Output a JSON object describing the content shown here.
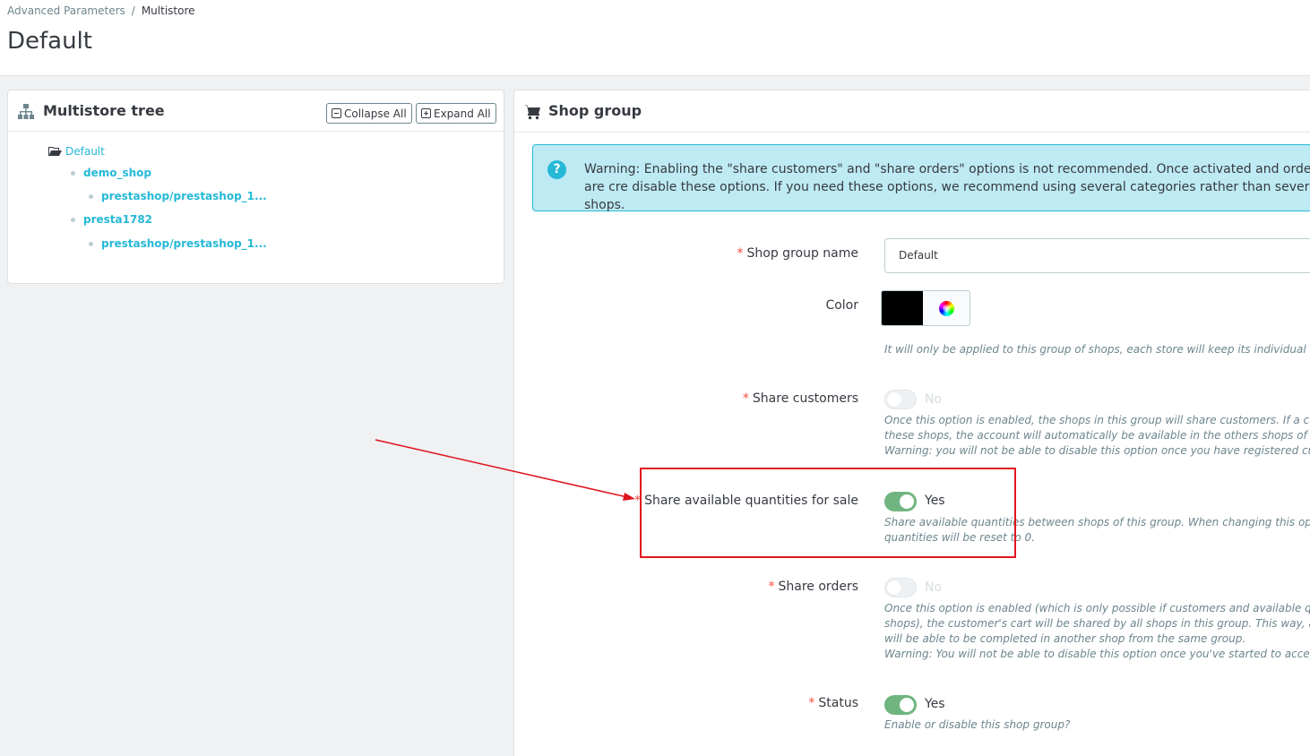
{
  "breadcrumb": {
    "parent": "Advanced Parameters",
    "separator": "/",
    "current": "Multistore"
  },
  "page": {
    "title": "Default"
  },
  "tree_panel": {
    "title": "Multistore tree",
    "collapse_label": "Collapse All",
    "expand_label": "Expand All",
    "nodes": {
      "group": "Default",
      "shop1": "demo_shop",
      "shop1_url": "prestashop/prestashop_1...",
      "shop2": "presta1782",
      "shop2_url": "prestashop/prestashop_1..."
    }
  },
  "form_panel": {
    "title": "Shop group",
    "alert_text": "Warning: Enabling the \"share customers\" and \"share orders\" options is not recommended. Once activated and orders are cre disable these options. If you need these options, we recommend using several categories rather than several shops.",
    "required_mark": "*",
    "fields": {
      "name": {
        "label": "Shop group name",
        "value": "Default"
      },
      "color": {
        "label": "Color",
        "value": "#000000",
        "help": "It will only be applied to this group of shops, each store will keep its individual color."
      },
      "share_customers": {
        "label": "Share customers",
        "state": "No",
        "help_1": "Once this option is enabled, the shops in this group will share customers. If a customer reg",
        "help_2": "these shops, the account will automatically be available in the others shops of this group.",
        "help_3": "Warning: you will not be able to disable this option once you have registered customers."
      },
      "share_stock": {
        "label": "Share available quantities for sale",
        "state": "Yes",
        "help_1": "Share available quantities between shops of this group. When changing this option, all ava",
        "help_2": "quantities will be reset to 0."
      },
      "share_orders": {
        "label": "Share orders",
        "state": "No",
        "help_1": "Once this option is enabled (which is only possible if customers and available quantities ar",
        "help_2": "shops), the customer's cart will be shared by all shops in this group. This way, any purchas",
        "help_3": "will be able to be completed in another shop from the same group.",
        "help_4": "Warning: You will not be able to disable this option once you've started to accept orders."
      },
      "status": {
        "label": "Status",
        "state": "Yes",
        "help": "Enable or disable this shop group?"
      }
    }
  },
  "colors": {
    "accent": "#25b9d7",
    "switch_on": "#70b580",
    "annotation": "#e0141e",
    "required": "#f54c3e"
  }
}
